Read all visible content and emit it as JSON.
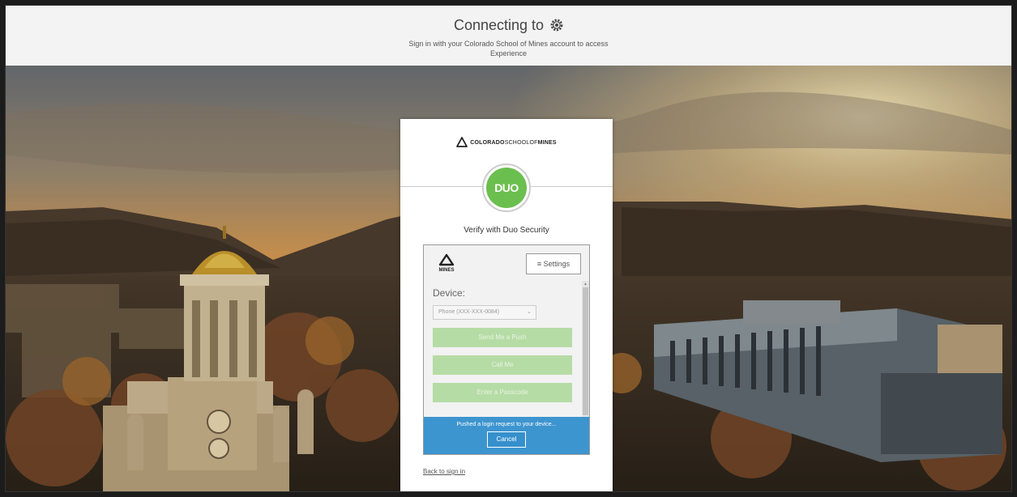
{
  "header": {
    "title": "Connecting to",
    "subtitle_line1": "Sign in with your Colorado School of Mines account to access",
    "subtitle_line2": "Experience"
  },
  "card": {
    "brand_part1": "COLORADO",
    "brand_part2": "SCHOOL",
    "brand_part3": "OF",
    "brand_part4": "MINES",
    "duo_logo_text": "DUO",
    "verify_text": "Verify with Duo Security"
  },
  "duo_frame": {
    "mines_logo_text": "MINES",
    "settings_label": "≡ Settings",
    "device_label": "Device:",
    "device_value": "Phone (XXX-XXX-0084)",
    "buttons": [
      "Send Me a Push",
      "Call Me",
      "Enter a Passcode"
    ],
    "push_message": "Pushed a login request to your device...",
    "cancel_label": "Cancel"
  },
  "footer": {
    "back_link": "Back to sign in"
  },
  "colors": {
    "duo_green": "#6bbf4e",
    "push_blue": "#3d95cf",
    "disabled_green": "#b6dca6"
  },
  "icons": [
    "gear-icon",
    "mines-triangle-icon",
    "chevron-down-icon",
    "menu-icon"
  ]
}
